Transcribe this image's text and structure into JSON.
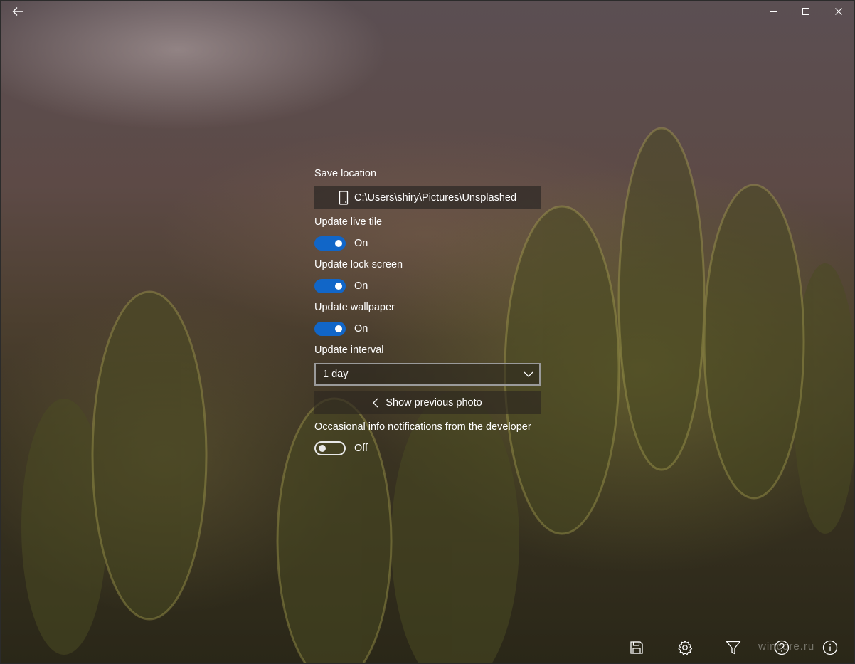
{
  "window": {
    "back_icon": "back-arrow-icon",
    "minimize_icon": "minimize-icon",
    "maximize_icon": "maximize-icon",
    "close_icon": "close-icon"
  },
  "settings": {
    "save_location": {
      "label": "Save location",
      "path": "C:\\Users\\shiry\\Pictures\\Unsplashed",
      "icon": "phone-device-icon"
    },
    "live_tile": {
      "label": "Update live tile",
      "state": "On",
      "on": true
    },
    "lock_screen": {
      "label": "Update lock screen",
      "state": "On",
      "on": true
    },
    "wallpaper": {
      "label": "Update wallpaper",
      "state": "On",
      "on": true
    },
    "interval": {
      "label": "Update interval",
      "selected": "1 day"
    },
    "previous_photo": {
      "label": "Show previous photo",
      "icon": "chevron-left-icon"
    },
    "notifications": {
      "label": "Occasional info notifications from the developer",
      "state": "Off",
      "on": false
    }
  },
  "bottom_bar": {
    "icons": [
      "save-icon",
      "gear-icon",
      "filter-icon",
      "help-icon",
      "info-icon"
    ]
  },
  "watermark": "wincore.ru",
  "colors": {
    "accent": "#1166c8",
    "text": "#ffffff"
  }
}
